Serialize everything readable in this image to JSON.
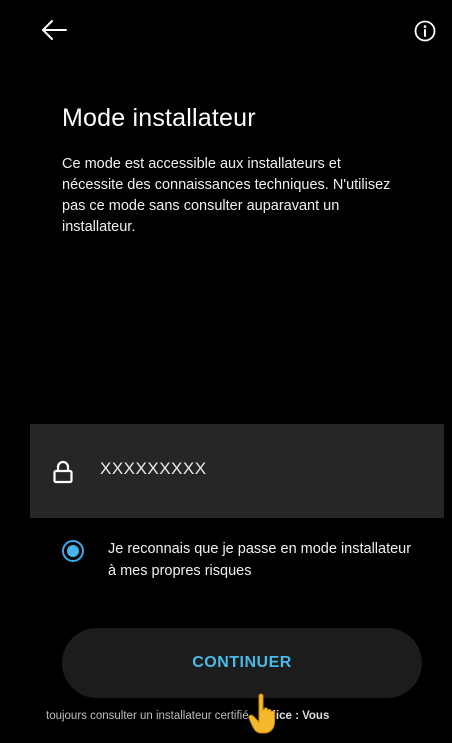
{
  "header": {
    "back_icon": "arrow-left-icon",
    "info_icon": "info-circle-icon"
  },
  "main": {
    "title": "Mode installateur",
    "description": "Ce mode est accessible aux installateurs et nécessite des connaissances techniques. N'utilisez pas ce mode sans consulter auparavant un installateur."
  },
  "password": {
    "icon": "lock-icon",
    "value": "XXXXXXXXX"
  },
  "consent": {
    "checked": true,
    "label": "Je reconnais que je passe en mode installateur à mes propres risques"
  },
  "actions": {
    "continue_label": "CONTINUER"
  },
  "ticker": {
    "text": "toujours consulter un installateur certifié",
    "hint_label": "Indice : Vous"
  },
  "colors": {
    "background": "#000000",
    "accent": "#45b4ef",
    "field_background": "#262626",
    "button_background": "#1c1c1c"
  }
}
